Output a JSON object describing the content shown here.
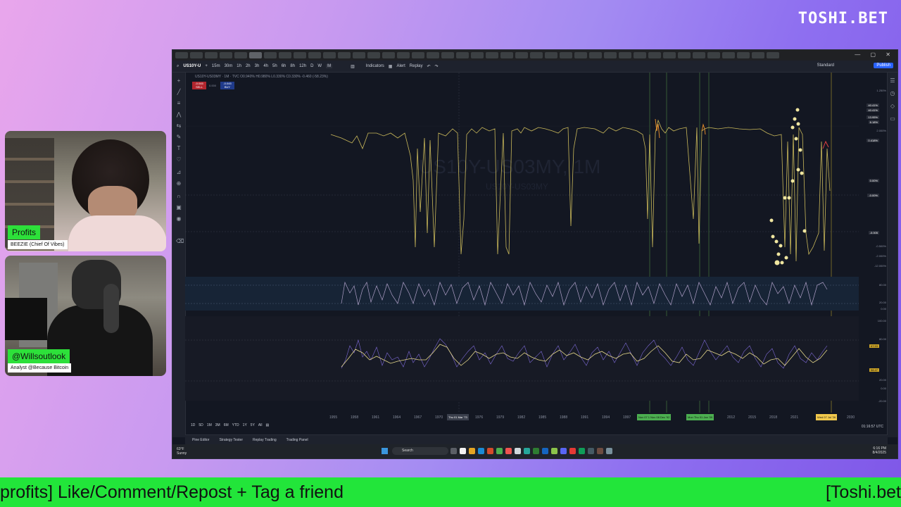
{
  "brand": "TOSHI.BET",
  "cams": [
    {
      "name_tag": "Profits",
      "subtitle": "BEEZIE (Chief Of Vibes)"
    },
    {
      "name_tag": "@Willsoutlook",
      "subtitle": "Analyst @Because Bitcoin"
    }
  ],
  "ticker": {
    "left": "profits] Like/Comment/Repost + Tag a friend",
    "right": "[Toshi.bet"
  },
  "toolbar": {
    "symbol": "US10Y-U",
    "intervals": [
      "15m",
      "30m",
      "1h",
      "2h",
      "3h",
      "4h",
      "5h",
      "6h",
      "8h",
      "12h",
      "D",
      "W",
      "M"
    ],
    "indicators": "Indicators",
    "alert": "Alert",
    "replay": "Replay",
    "layout": "Standard",
    "publish": "Publish"
  },
  "legend": "US10Y-US03MY · 1M · TVC  O0.940%  H0.980%  L0.330%  C0.330%  -0.460 (-58.23%)",
  "pills": {
    "sell": "-0.045 SELL",
    "buy": "-0.045 BUY",
    "mid": "0.000"
  },
  "watermark": {
    "title": "US10Y-US03MY, 1M",
    "sub": "US10Y-US03MY"
  },
  "chart_data": {
    "type": "line",
    "title": "US10Y-US03MY, 1M",
    "x_ticks": [
      "1955",
      "1958",
      "1961",
      "1964",
      "1967",
      "1970",
      "1976",
      "1979",
      "1982",
      "1985",
      "1988",
      "1991",
      "1994",
      "1997",
      "2012",
      "2015",
      "2018",
      "2021",
      "2024",
      "2030"
    ],
    "highlighted_dates": [
      "Thu 01 Mar '73",
      "Nov 07 1  Nov 08 Dec '92",
      "Mon  Thu 01 Jan '09",
      "Wed 07 Jul '26"
    ],
    "price_labels": [
      "1.250%",
      "40.41%",
      "40.41%",
      "13.95%",
      "6.18%",
      "2.000%",
      "0.418%",
      "0.00%",
      "-0.00%",
      "-0.005",
      "-0.500%",
      "-2.000%",
      "-12.000%"
    ],
    "osc1_axis": [
      "80.00",
      "20.00",
      "0.00"
    ],
    "osc2_axis": [
      "100.00",
      "80.00",
      "67.53",
      "58.47",
      "20.00",
      "0.00",
      "-20.00"
    ]
  },
  "range_buttons": [
    "1D",
    "5D",
    "1M",
    "3M",
    "6M",
    "YTD",
    "1Y",
    "5Y",
    "All"
  ],
  "clock": "01:16:57 UTC",
  "bottom_tabs": [
    "Pine Editor",
    "Strategy Tester",
    "Replay Trading",
    "Trading Panel"
  ],
  "taskbar": {
    "weather_temp": "63°F",
    "weather_desc": "Sunny",
    "search": "Search",
    "time": "6:16 PM",
    "date": "8/4/2025"
  }
}
